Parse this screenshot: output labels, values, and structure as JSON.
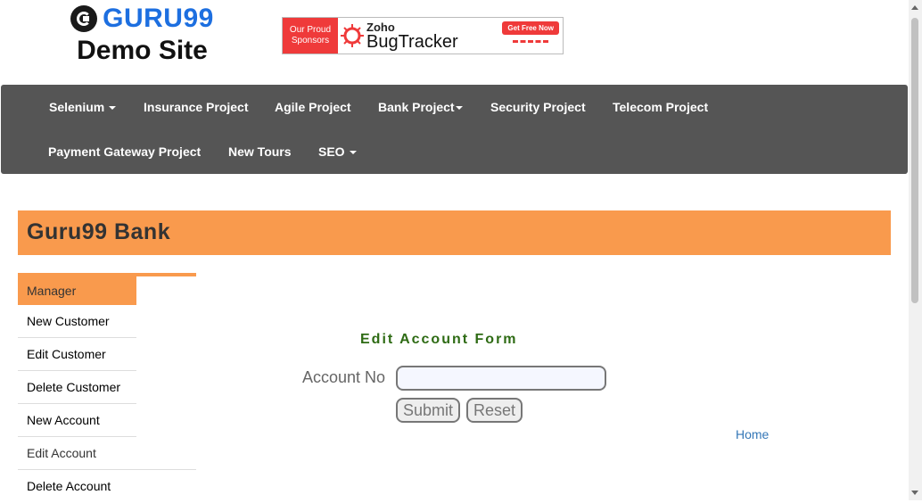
{
  "logo": {
    "word": "GURU99",
    "subtitle": "Demo Site"
  },
  "banner": {
    "line1": "Our Proud",
    "line2": "Sponsors",
    "brand_small": "Zoho",
    "brand_big": "BugTracker",
    "cta": "Get Free Now"
  },
  "nav": {
    "selenium": "Selenium",
    "insurance": "Insurance Project",
    "agile": "Agile Project",
    "bank": "Bank Project",
    "security": "Security Project",
    "telecom": "Telecom Project",
    "payment": "Payment Gateway Project",
    "tours": "New Tours",
    "seo": "SEO"
  },
  "bank_header": {
    "title": "Guru99 Bank"
  },
  "sidebar": {
    "items": [
      {
        "label": "Manager"
      },
      {
        "label": "New Customer"
      },
      {
        "label": "Edit Customer"
      },
      {
        "label": "Delete Customer"
      },
      {
        "label": "New Account"
      },
      {
        "label": "Edit Account"
      },
      {
        "label": "Delete Account"
      }
    ]
  },
  "form": {
    "title": "Edit Account Form",
    "account_label": "Account No",
    "account_value": "",
    "submit": "Submit",
    "reset": "Reset",
    "home": "Home"
  },
  "colors": {
    "accent": "#f99a4d",
    "nav_bg": "#555555",
    "title_green": "#2e6b14"
  }
}
